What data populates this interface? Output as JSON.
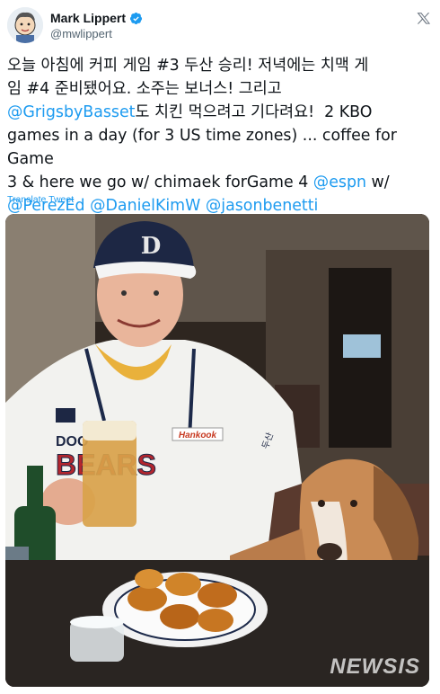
{
  "tweet": {
    "display_name": "Mark Lippert",
    "handle": "@mwlippert",
    "verified": true,
    "text_line1": "오늘 아침에 커피 게임 #3 두산 승리! 저녁에는 치맥 게",
    "text_line2": "임 #4 준비됐어요. 소주는 보너스! 그리고",
    "mention_grigsby": "@GrigsbyBasset",
    "text_line3_rest": "도 치킨 먹으려고 기다려요!  2 KBO",
    "text_line4": "games in a day (for 3 US time zones) ... coffee for Game",
    "text_line5_a": "3 & here we go w/ chimaek forGame 4 ",
    "mention_espn": "@espn",
    "text_line5_b": " w/",
    "mention_perez": "@PerezEd",
    "mention_daniel": "@DanielKimW",
    "mention_jason": "@jasonbenetti",
    "translate_label": "Translate Tweet"
  },
  "photo": {
    "cap_letter": "D",
    "jersey_text": "BEARS",
    "jersey_partial": "DOO",
    "sponsor": "Hankook",
    "sleeve_text": "두산",
    "watermark": "NEWSIS"
  },
  "colors": {
    "link": "#1d9bf0",
    "verified": "#1d9bf0",
    "text": "#0f1419",
    "muted": "#536471"
  },
  "icons": {
    "verified": "verified-badge-icon",
    "platform": "x-logo-icon"
  }
}
